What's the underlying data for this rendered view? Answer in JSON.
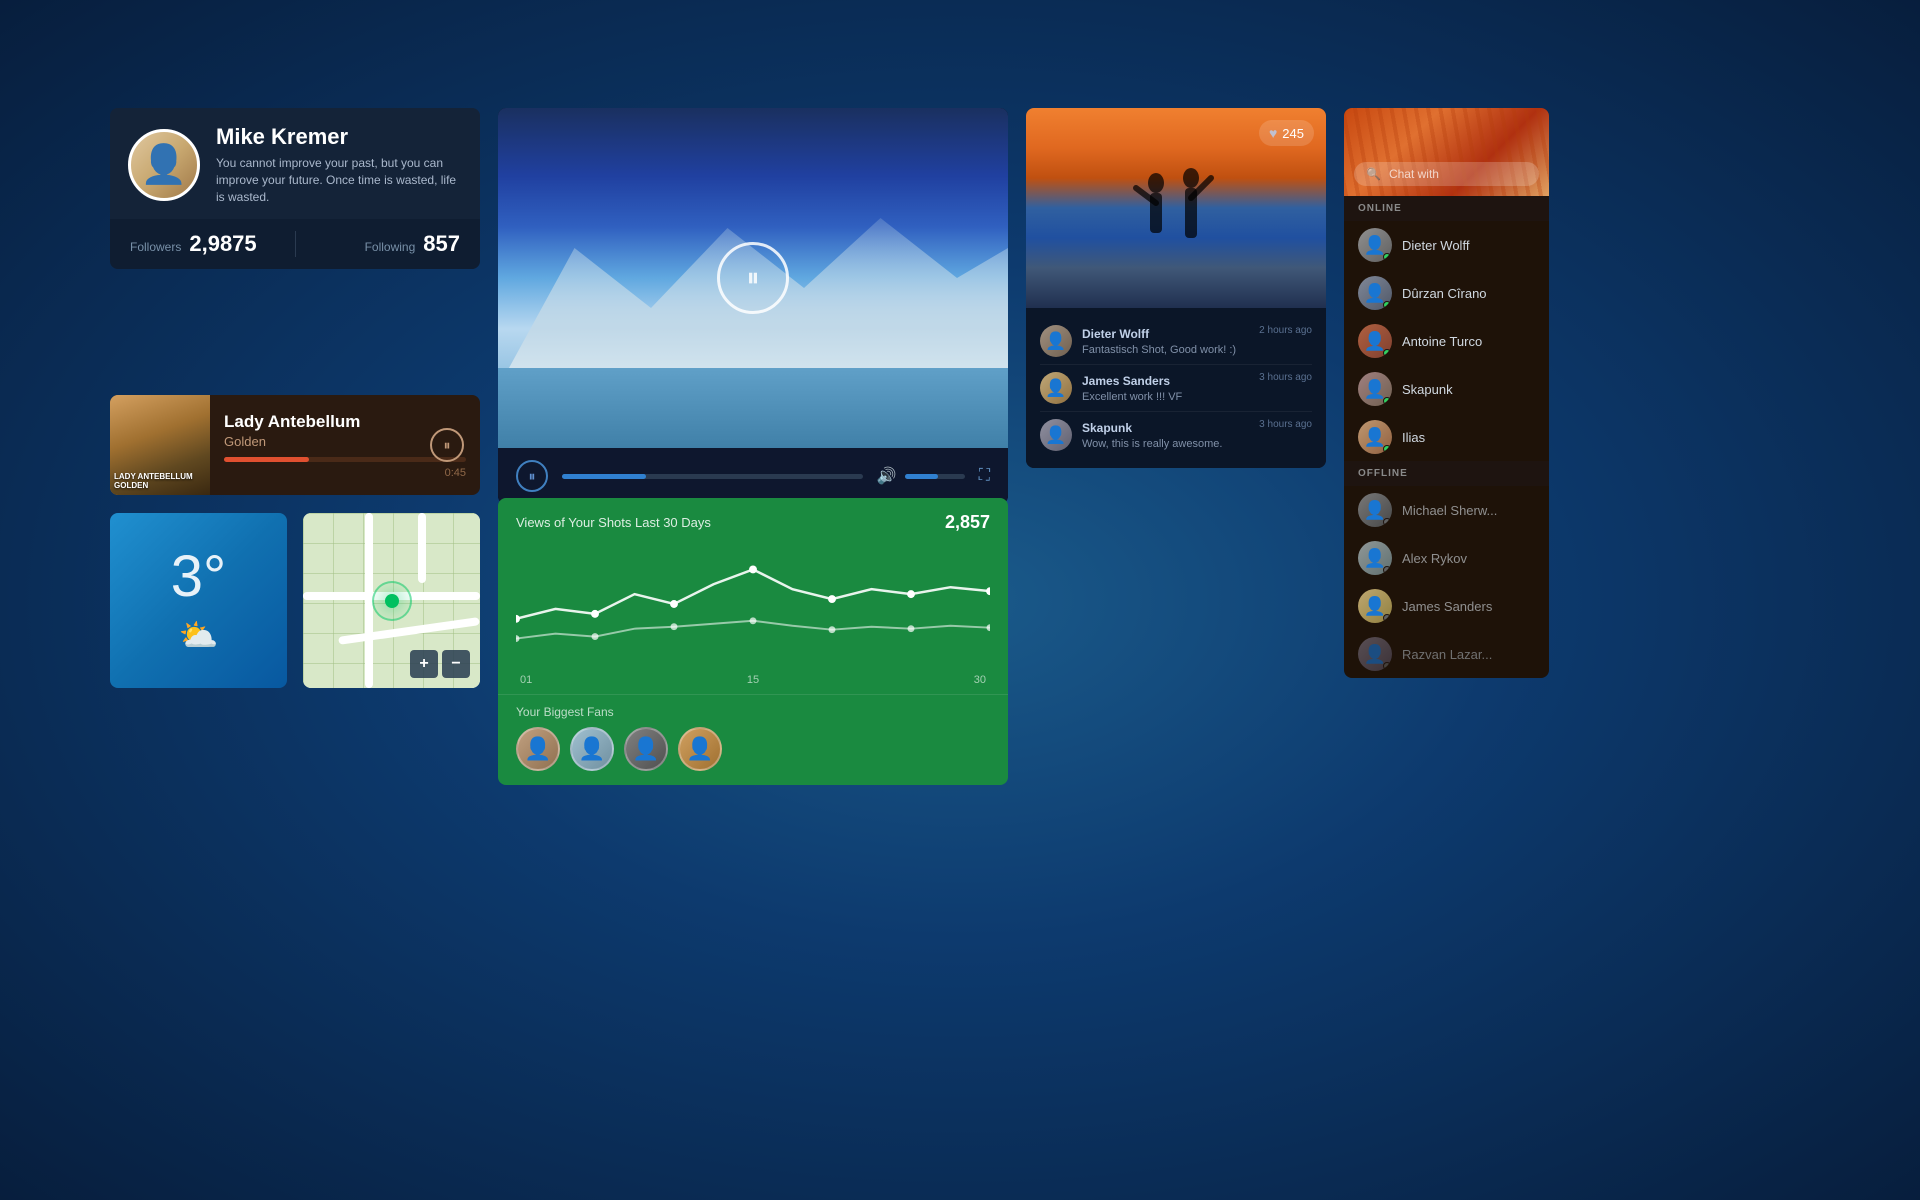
{
  "profile": {
    "name": "Mike Kremer",
    "bio": "You cannot improve your past, but you can improve your future. Once time is wasted, life is wasted.",
    "followers_label": "Followers",
    "followers_value": "2,9875",
    "following_label": "Following",
    "following_value": "857"
  },
  "music": {
    "title": "Lady Antebellum",
    "album": "Golden",
    "time": "0:45",
    "progress_pct": 35
  },
  "weather": {
    "temp": "3°",
    "icon": "⛅"
  },
  "map": {
    "zoom_in": "+",
    "zoom_out": "−"
  },
  "video": {
    "progress_pct": 28
  },
  "chart": {
    "title": "Views of Your Shots Last 30 Days",
    "peak_value": "2,857",
    "x_labels": [
      "01",
      "15",
      "30"
    ],
    "fans_label": "Your Biggest Fans"
  },
  "photo": {
    "like_count": "245",
    "comments": [
      {
        "name": "Dieter Wolff",
        "time": "2 hours ago",
        "text": "Fantastisch Shot, Good work! :)"
      },
      {
        "name": "James Sanders",
        "time": "3 hours ago",
        "text": "Excellent work !!! VF"
      },
      {
        "name": "Skapunk",
        "time": "3 hours ago",
        "text": "Wow, this is really awesome."
      }
    ]
  },
  "chat": {
    "search_placeholder": "Chat with",
    "online_label": "ONLINE",
    "offline_label": "OFFLINE",
    "online_users": [
      {
        "name": "Dieter Wolff"
      },
      {
        "name": "Dûrzan Cîrano"
      },
      {
        "name": "Antoine Turco"
      },
      {
        "name": "Skapunk"
      },
      {
        "name": "Ilias"
      }
    ],
    "offline_users": [
      {
        "name": "Michael Sherw..."
      },
      {
        "name": "Alex Rykov"
      },
      {
        "name": "James Sanders"
      },
      {
        "name": "Razvan Lazar..."
      }
    ]
  }
}
